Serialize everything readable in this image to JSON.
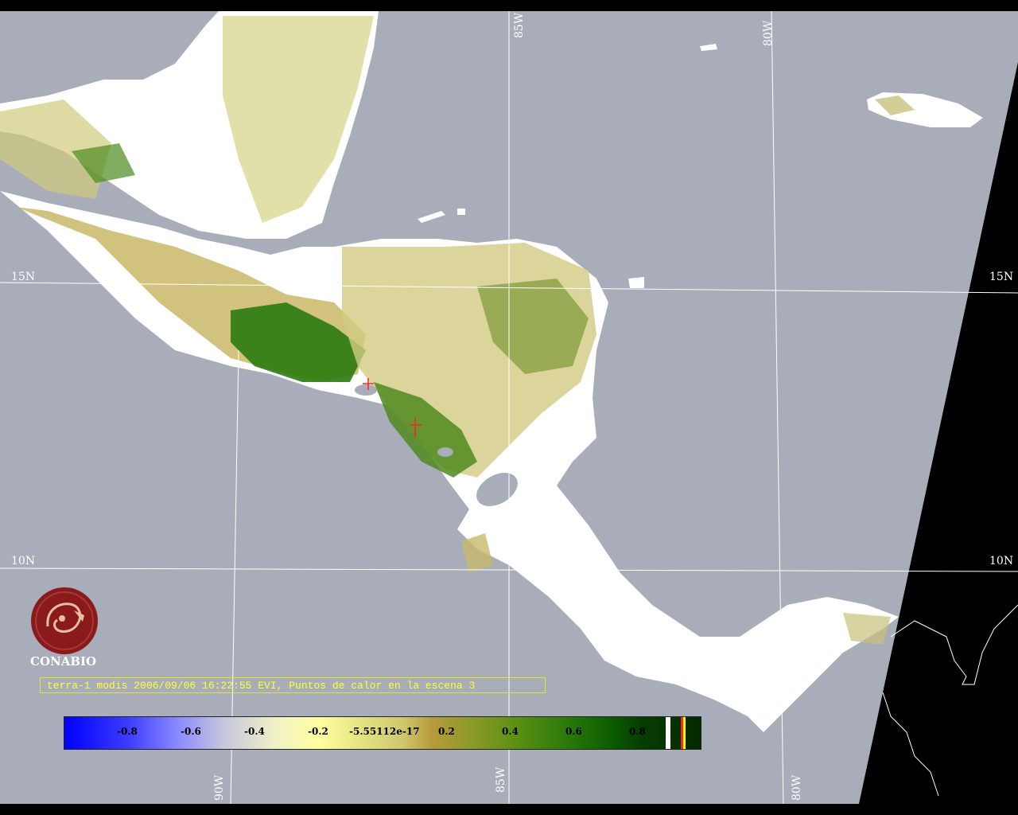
{
  "map": {
    "lat_labels": [
      "15N",
      "15N",
      "10N",
      "10N"
    ],
    "lon_labels": [
      "85W",
      "80W",
      "90W",
      "85W",
      "80W"
    ]
  },
  "logo": {
    "name": "CONABIO"
  },
  "caption": "terra-1 modis 2006/09/06 16:22:55 EVI, Puntos de calor en la escena 3",
  "colorbar": {
    "ticks": [
      "-0.8",
      "-0.6",
      "-0.4",
      "-0.2",
      "-5.55112e-17",
      "0.2",
      "0.4",
      "0.6",
      "0.8"
    ],
    "scale_min": -1.0,
    "scale_max": 1.0
  },
  "colors": {
    "ocean": "#a9adb9",
    "cloud": "#ffffff",
    "swath_edge": "#000000",
    "grid": "#ffffff",
    "caption": "#ffff33",
    "hotspot": "#ff2020",
    "logo": "#8b1a1a"
  }
}
